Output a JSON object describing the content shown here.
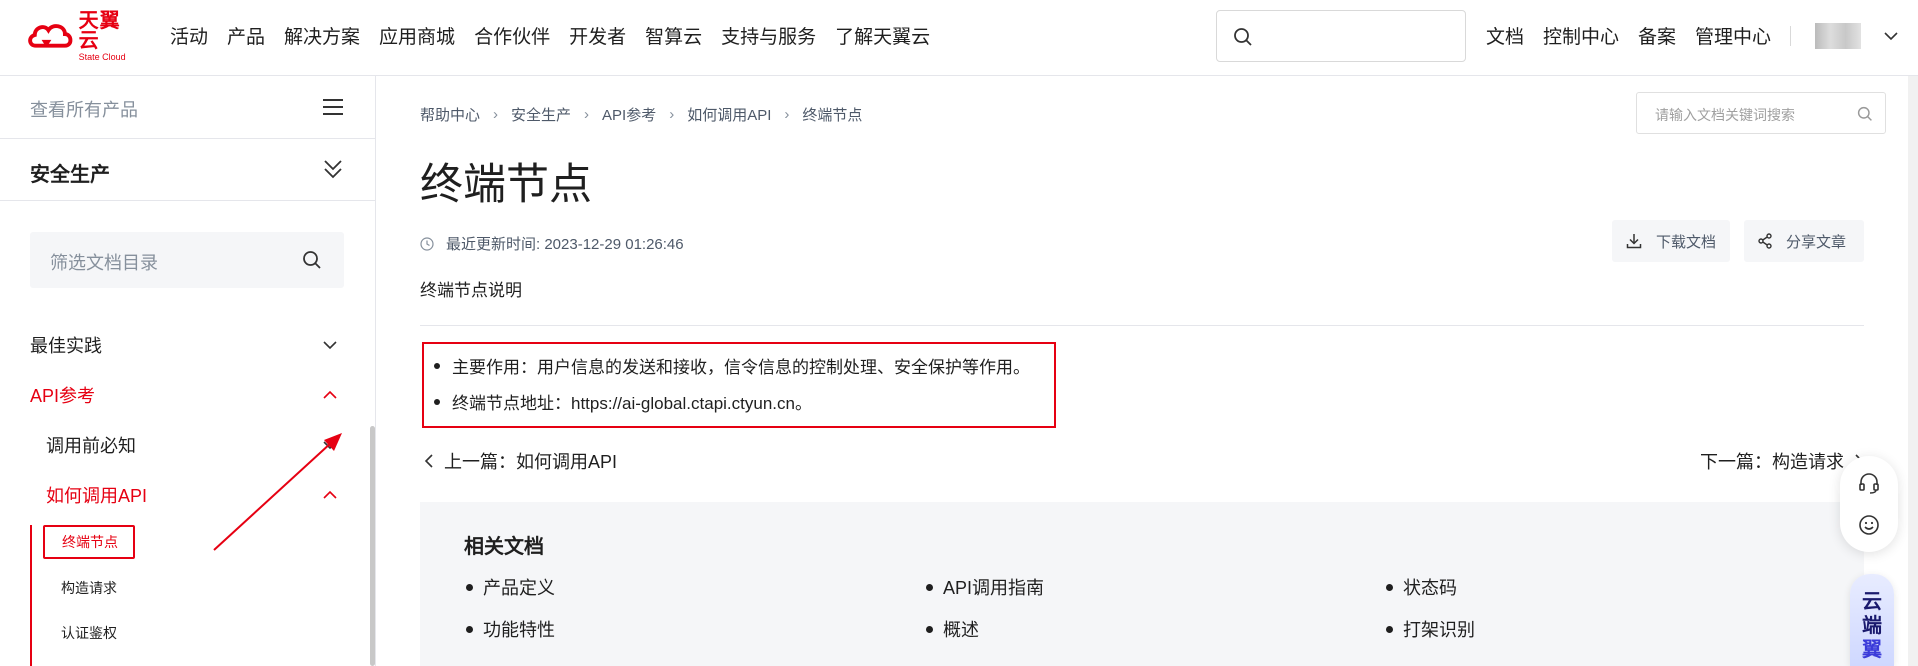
{
  "header": {
    "logo": {
      "cn": "天翼云",
      "en": "State Cloud"
    },
    "nav": [
      "活动",
      "产品",
      "解决方案",
      "应用商城",
      "合作伙伴",
      "开发者",
      "智算云",
      "支持与服务",
      "了解天翼云"
    ],
    "right_links": [
      "文档",
      "控制中心",
      "备案",
      "管理中心"
    ]
  },
  "sidebar": {
    "all_products": "查看所有产品",
    "product": "安全生产",
    "filter_placeholder": "筛选文档目录",
    "items": [
      {
        "label": "最佳实践"
      },
      {
        "label": "API参考"
      },
      {
        "label": "调用前必知"
      },
      {
        "label": "如何调用API"
      },
      {
        "label": "终端节点"
      },
      {
        "label": "构造请求"
      },
      {
        "label": "认证鉴权"
      }
    ]
  },
  "breadcrumb": [
    "帮助中心",
    "安全生产",
    "API参考",
    "如何调用API",
    "终端节点"
  ],
  "doc_search_placeholder": "请输入文档关键词搜索",
  "doc": {
    "title": "终端节点",
    "updated": "最近更新时间: 2023-12-29 01:26:46",
    "download": "下载文档",
    "share": "分享文章",
    "description": "终端节点说明",
    "bullets": [
      "主要作用：用户信息的发送和接收，信令信息的控制处理、安全保护等作用。",
      "终端节点地址：https://ai-global.ctapi.ctyun.cn。"
    ],
    "prev": "上一篇：如何调用API",
    "next": "下一篇：构造请求"
  },
  "related": {
    "title": "相关文档",
    "items": [
      "产品定义",
      "API调用指南",
      "状态码",
      "功能特性",
      "概述",
      "打架识别"
    ]
  },
  "float_ad": {
    "line1": "云端",
    "line2": "翼"
  },
  "colors": {
    "brand_red": "#e60012",
    "text": "#1f1f1f",
    "muted": "#86909c"
  }
}
